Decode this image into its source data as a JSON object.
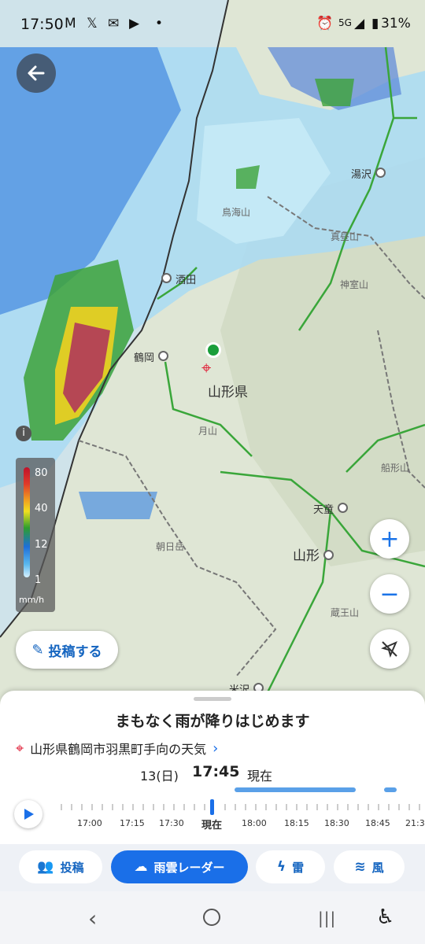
{
  "status_bar": {
    "time": "17:50",
    "icons": [
      "gmail-icon",
      "x-icon",
      "mail-icon",
      "youtube-icon",
      "dot-icon"
    ],
    "network": "5G",
    "battery": "31%"
  },
  "map": {
    "places": [
      {
        "name": "湯沢",
        "kind": "city"
      },
      {
        "name": "鳥海山",
        "kind": "mountain"
      },
      {
        "name": "真昼山",
        "kind": "mountain"
      },
      {
        "name": "神室山",
        "kind": "mountain"
      },
      {
        "name": "酒田",
        "kind": "city"
      },
      {
        "name": "鶴岡",
        "kind": "city"
      },
      {
        "name": "山形県",
        "kind": "prefecture"
      },
      {
        "name": "月山",
        "kind": "mountain"
      },
      {
        "name": "船形山",
        "kind": "mountain"
      },
      {
        "name": "天童",
        "kind": "city"
      },
      {
        "name": "朝日岳",
        "kind": "mountain"
      },
      {
        "name": "山形",
        "kind": "city"
      },
      {
        "name": "蔵王山",
        "kind": "mountain"
      },
      {
        "name": "米沢",
        "kind": "city"
      }
    ],
    "legend": {
      "labels": [
        "80",
        "40",
        "12",
        "1"
      ],
      "unit": "mm/h"
    },
    "post_button": "投稿する"
  },
  "sheet": {
    "headline": "まもなく雨が降りはじめます",
    "location": "山形県鶴岡市羽黒町手向の天気",
    "date": "13(日)",
    "time": "17:45",
    "now_label": "現在",
    "timeline": [
      "17:00",
      "17:15",
      "17:30",
      "現在",
      "18:00",
      "18:15",
      "18:30",
      "18:45",
      "21:3"
    ]
  },
  "tabs": [
    {
      "label": "投稿",
      "icon": "people-icon",
      "active": false
    },
    {
      "label": "雨雲レーダー",
      "icon": "rain-cloud-icon",
      "active": true
    },
    {
      "label": "雷",
      "icon": "lightning-icon",
      "active": false
    },
    {
      "label": "風",
      "icon": "wind-icon",
      "active": false
    }
  ],
  "colors": {
    "accent": "#1a6fe8",
    "rain_light": "#9fd6f2",
    "rain_mid": "#3a82d8",
    "rain_heavy": "#b0395a"
  }
}
